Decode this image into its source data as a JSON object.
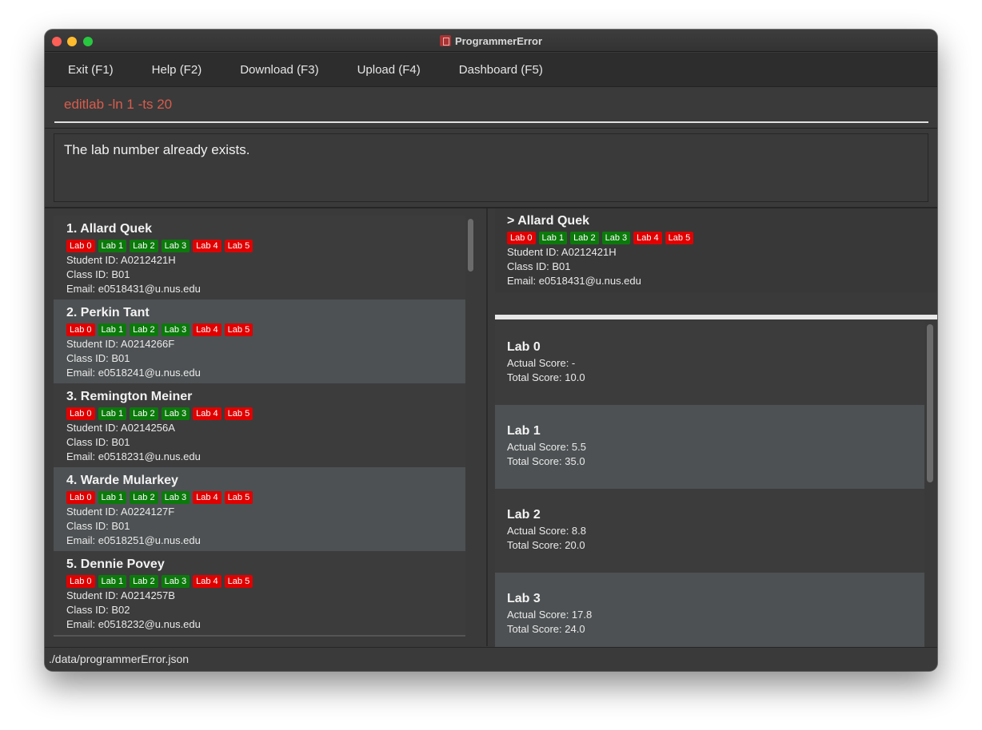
{
  "window": {
    "title": "ProgrammerError"
  },
  "menu": [
    {
      "label": "Exit (F1)"
    },
    {
      "label": "Help (F2)"
    },
    {
      "label": "Download (F3)"
    },
    {
      "label": "Upload (F4)"
    },
    {
      "label": "Dashboard (F5)"
    }
  ],
  "command": {
    "value": "editlab -ln 1 -ts 20"
  },
  "result": {
    "message": "The lab number already exists."
  },
  "students": [
    {
      "name": "1.  Allard Quek",
      "student_id": "Student ID: A0212421H",
      "class_id": "Class ID: B01",
      "email": "Email: e0518431@u.nus.edu",
      "labs": [
        {
          "label": "Lab 0",
          "status": "red"
        },
        {
          "label": "Lab 1",
          "status": "green"
        },
        {
          "label": "Lab 2",
          "status": "green"
        },
        {
          "label": "Lab 3",
          "status": "green"
        },
        {
          "label": "Lab 4",
          "status": "red"
        },
        {
          "label": "Lab 5",
          "status": "red"
        }
      ]
    },
    {
      "name": "2.  Perkin Tant",
      "student_id": "Student ID: A0214266F",
      "class_id": "Class ID: B01",
      "email": "Email: e0518241@u.nus.edu",
      "labs": [
        {
          "label": "Lab 0",
          "status": "red"
        },
        {
          "label": "Lab 1",
          "status": "green"
        },
        {
          "label": "Lab 2",
          "status": "green"
        },
        {
          "label": "Lab 3",
          "status": "green"
        },
        {
          "label": "Lab 4",
          "status": "red"
        },
        {
          "label": "Lab 5",
          "status": "red"
        }
      ]
    },
    {
      "name": "3.  Remington Meiner",
      "student_id": "Student ID: A0214256A",
      "class_id": "Class ID: B01",
      "email": "Email: e0518231@u.nus.edu",
      "labs": [
        {
          "label": "Lab 0",
          "status": "red"
        },
        {
          "label": "Lab 1",
          "status": "green"
        },
        {
          "label": "Lab 2",
          "status": "green"
        },
        {
          "label": "Lab 3",
          "status": "green"
        },
        {
          "label": "Lab 4",
          "status": "red"
        },
        {
          "label": "Lab 5",
          "status": "red"
        }
      ]
    },
    {
      "name": "4.  Warde Mularkey",
      "student_id": "Student ID: A0224127F",
      "class_id": "Class ID: B01",
      "email": "Email: e0518251@u.nus.edu",
      "labs": [
        {
          "label": "Lab 0",
          "status": "red"
        },
        {
          "label": "Lab 1",
          "status": "green"
        },
        {
          "label": "Lab 2",
          "status": "green"
        },
        {
          "label": "Lab 3",
          "status": "green"
        },
        {
          "label": "Lab 4",
          "status": "red"
        },
        {
          "label": "Lab 5",
          "status": "red"
        }
      ]
    },
    {
      "name": "5.  Dennie Povey",
      "student_id": "Student ID: A0214257B",
      "class_id": "Class ID: B02",
      "email": "Email: e0518232@u.nus.edu",
      "labs": [
        {
          "label": "Lab 0",
          "status": "red"
        },
        {
          "label": "Lab 1",
          "status": "green"
        },
        {
          "label": "Lab 2",
          "status": "green"
        },
        {
          "label": "Lab 3",
          "status": "green"
        },
        {
          "label": "Lab 4",
          "status": "red"
        },
        {
          "label": "Lab 5",
          "status": "red"
        }
      ]
    }
  ],
  "detail": {
    "name": "> Allard Quek",
    "student_id": "Student ID: A0212421H",
    "class_id": "Class ID: B01",
    "email": "Email: e0518431@u.nus.edu",
    "labs": [
      {
        "label": "Lab 0",
        "status": "red"
      },
      {
        "label": "Lab 1",
        "status": "green"
      },
      {
        "label": "Lab 2",
        "status": "green"
      },
      {
        "label": "Lab 3",
        "status": "green"
      },
      {
        "label": "Lab 4",
        "status": "red"
      },
      {
        "label": "Lab 5",
        "status": "red"
      }
    ]
  },
  "lab_results": [
    {
      "title": "Lab 0",
      "actual": "Actual Score: -",
      "total": "Total Score: 10.0"
    },
    {
      "title": "Lab 1",
      "actual": "Actual Score: 5.5",
      "total": "Total Score: 35.0"
    },
    {
      "title": "Lab 2",
      "actual": "Actual Score: 8.8",
      "total": "Total Score: 20.0"
    },
    {
      "title": "Lab 3",
      "actual": "Actual Score: 17.8",
      "total": "Total Score: 24.0"
    }
  ],
  "status_bar": {
    "path": "./data/programmerError.json"
  },
  "colors": {
    "tag_red": "#e00000",
    "tag_green": "#0b7a0b",
    "command_text": "#d95c4c"
  },
  "icons": {
    "app": "book-icon"
  }
}
